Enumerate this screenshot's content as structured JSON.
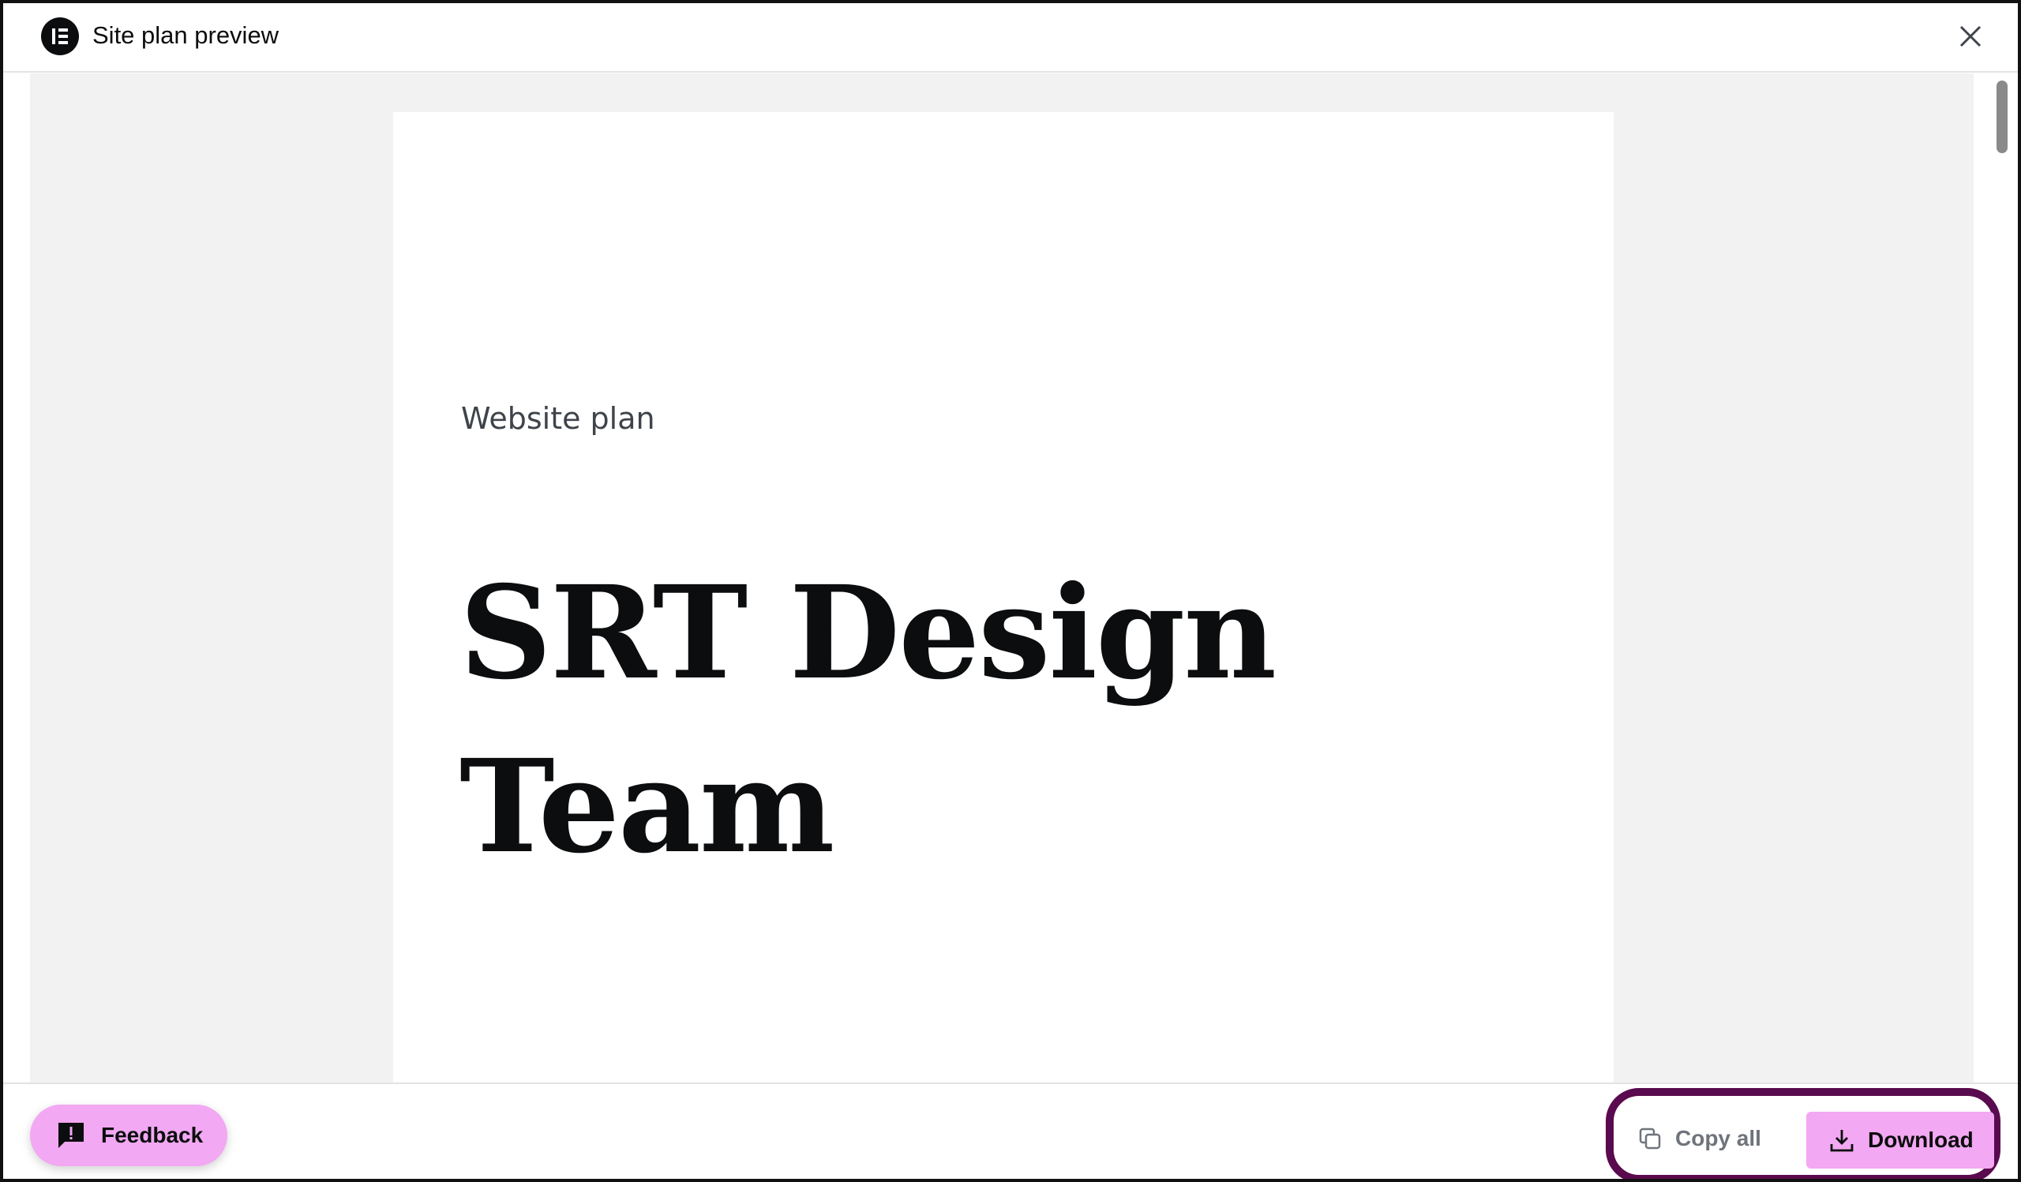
{
  "header": {
    "title": "Site plan preview",
    "logo_icon": "elementor-logo-icon",
    "close_icon": "close-icon"
  },
  "document": {
    "kicker": "Website plan",
    "title_line1": "SRT Design",
    "title_line2": "Team"
  },
  "footer": {
    "feedback_label": "Feedback",
    "copy_label": "Copy all",
    "download_label": "Download"
  },
  "colors": {
    "accent_pink": "#f2a8f2",
    "highlight_border": "#5a0a4e",
    "preview_bg": "#f2f2f2"
  }
}
